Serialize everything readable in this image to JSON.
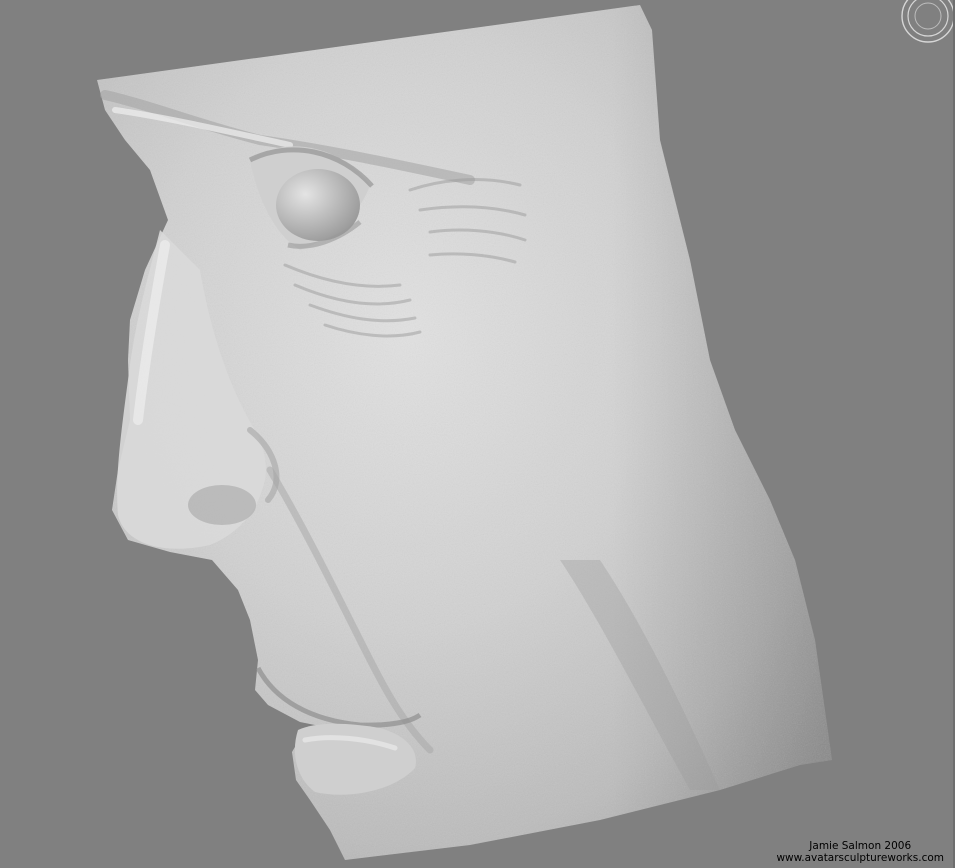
{
  "canvas": {
    "background_color": "#808080",
    "surface_color": "#d8d8d8",
    "shadow_color": "#8c8c8c"
  },
  "viewport": {
    "model": "sculpted face, profile view"
  },
  "gizmo": {
    "icon": "rotate-gizmo-icon"
  },
  "credit": {
    "author": "Jamie Salmon 2006",
    "url": "www.avatarsculptureworks.com"
  }
}
